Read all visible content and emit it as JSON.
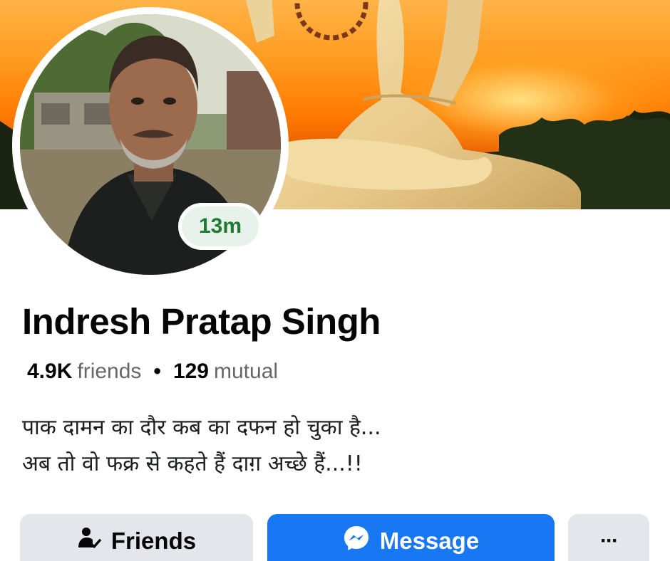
{
  "profile": {
    "name": "Indresh Pratap Singh",
    "active_time": "13m",
    "friends_count": "4.9K",
    "friends_label": "friends",
    "separator": "•",
    "mutual_count": "129",
    "mutual_label": "mutual",
    "bio_lines": [
      "पाक दामन का दौर कब का दफन हो चुका है...",
      "अब तो वो फक्र से कहते हैं दाग़ अच्छे हैं...!!"
    ]
  },
  "actions": {
    "friends_label": "Friends",
    "message_label": "Message",
    "more_label": "···"
  },
  "icons": {
    "friends": "person-check-icon",
    "message": "messenger-icon",
    "more": "more-dots-icon"
  },
  "colors": {
    "primary_blue": "#1877f2",
    "button_gray": "#e4e6eb",
    "badge_bg": "#e7f3ea",
    "badge_text": "#1f7a33",
    "secondary_text": "#65676b"
  }
}
